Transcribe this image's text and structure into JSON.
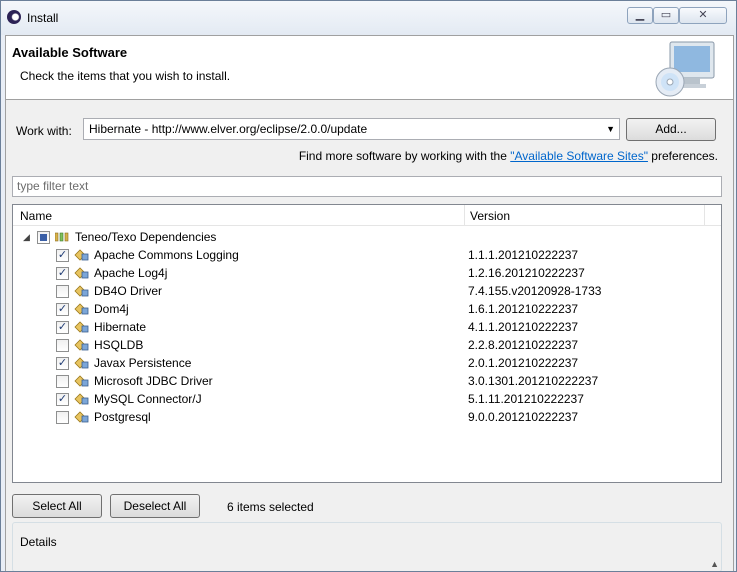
{
  "window": {
    "title": "Install"
  },
  "banner": {
    "heading": "Available Software",
    "subtitle": "Check the items that you wish to install."
  },
  "work_with": {
    "label": "Work with:",
    "value": "Hibernate - http://www.elver.org/eclipse/2.0.0/update",
    "add_label": "Add...",
    "find_prefix": "Find more software by working with the",
    "find_link": "\"Available Software Sites\"",
    "find_suffix": "preferences."
  },
  "filter": {
    "placeholder": "type filter text"
  },
  "table": {
    "col_name": "Name",
    "col_version": "Version",
    "category": "Teneo/Texo Dependencies",
    "items": [
      {
        "name": "Apache Commons Logging",
        "version": "1.1.1.201210222237",
        "checked": true
      },
      {
        "name": "Apache Log4j",
        "version": "1.2.16.201210222237",
        "checked": true
      },
      {
        "name": "DB4O Driver",
        "version": "7.4.155.v20120928-1733",
        "checked": false
      },
      {
        "name": "Dom4j",
        "version": "1.6.1.201210222237",
        "checked": true
      },
      {
        "name": "Hibernate",
        "version": "4.1.1.201210222237",
        "checked": true
      },
      {
        "name": "HSQLDB",
        "version": "2.2.8.201210222237",
        "checked": false
      },
      {
        "name": "Javax Persistence",
        "version": "2.0.1.201210222237",
        "checked": true
      },
      {
        "name": "Microsoft JDBC Driver",
        "version": "3.0.1301.201210222237",
        "checked": false
      },
      {
        "name": "MySQL Connector/J",
        "version": "5.1.11.201210222237",
        "checked": true
      },
      {
        "name": "Postgresql",
        "version": "9.0.0.201210222237",
        "checked": false
      }
    ]
  },
  "actions": {
    "select_all": "Select All",
    "deselect_all": "Deselect All",
    "selected_count": "6 items selected"
  },
  "details": {
    "label": "Details"
  }
}
